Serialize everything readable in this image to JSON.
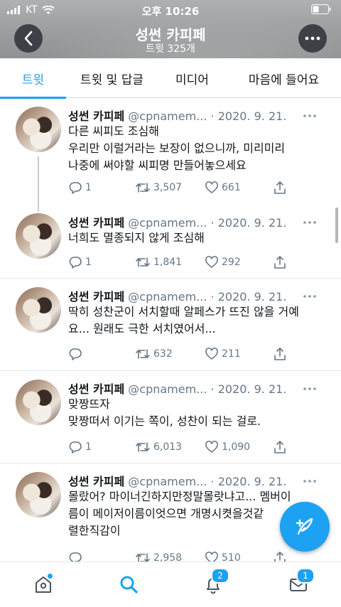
{
  "status_bar": {
    "carrier": "KT",
    "time": "오후 10:26"
  },
  "header": {
    "title": "성썬 카피페",
    "subtitle": "트윗 325개"
  },
  "tabs": [
    {
      "label": "트윗",
      "active": true
    },
    {
      "label": "트윗 및 답글",
      "active": false
    },
    {
      "label": "미디어",
      "active": false
    },
    {
      "label": "마음에 들어요",
      "active": false
    }
  ],
  "tweets": [
    {
      "name": "성썬 카피페",
      "handle": "@cpnamem...",
      "date": "· 2020. 9. 21.",
      "lines": [
        "다른 씨피도 조심해",
        "우리만 이럴거라는 보장이 없으니까, 미리미리",
        "나중에 써야할 씨피명 만들어놓으세요"
      ],
      "replies": "1",
      "retweets": "3,507",
      "likes": "661"
    },
    {
      "name": "성썬 카피페",
      "handle": "@cpnamem...",
      "date": "· 2020. 9. 21.",
      "lines": [
        "너희도 멸종되지 않게 조심해"
      ],
      "replies": "1",
      "retweets": "1,841",
      "likes": "292"
    },
    {
      "name": "성썬 카피페",
      "handle": "@cpnamem...",
      "date": "· 2020. 9. 21.",
      "lines": [
        "딱히 성찬군이 서치할때 알페스가 뜨진 않을 거예",
        "요... 원래도 극한 서치였어서..."
      ],
      "replies": "",
      "retweets": "632",
      "likes": "211"
    },
    {
      "name": "성썬 카피페",
      "handle": "@cpnamem...",
      "date": "· 2020. 9. 21.",
      "lines": [
        "맞짱뜨자",
        "맞짱떠서 이기는 쪽이, 성찬이 되는 걸로."
      ],
      "replies": "1",
      "retweets": "6,013",
      "likes": "1,090"
    },
    {
      "name": "성썬 카피페",
      "handle": "@cpnamem...",
      "date": "· 2020. 9. 21.",
      "lines": [
        "몰랐어? 마이너긴하지만정말몰랏냐고... 멤버이",
        "름이 메이저이름이엇으면 개명시켯을것같",
        "렬한직감이"
      ],
      "replies": "",
      "retweets": "2,958",
      "likes": "510"
    }
  ],
  "bottom_nav": {
    "notifications_badge": "2",
    "messages_badge": "1"
  },
  "colors": {
    "accent": "#1da1f2",
    "text": "#14171a",
    "muted": "#657786"
  }
}
